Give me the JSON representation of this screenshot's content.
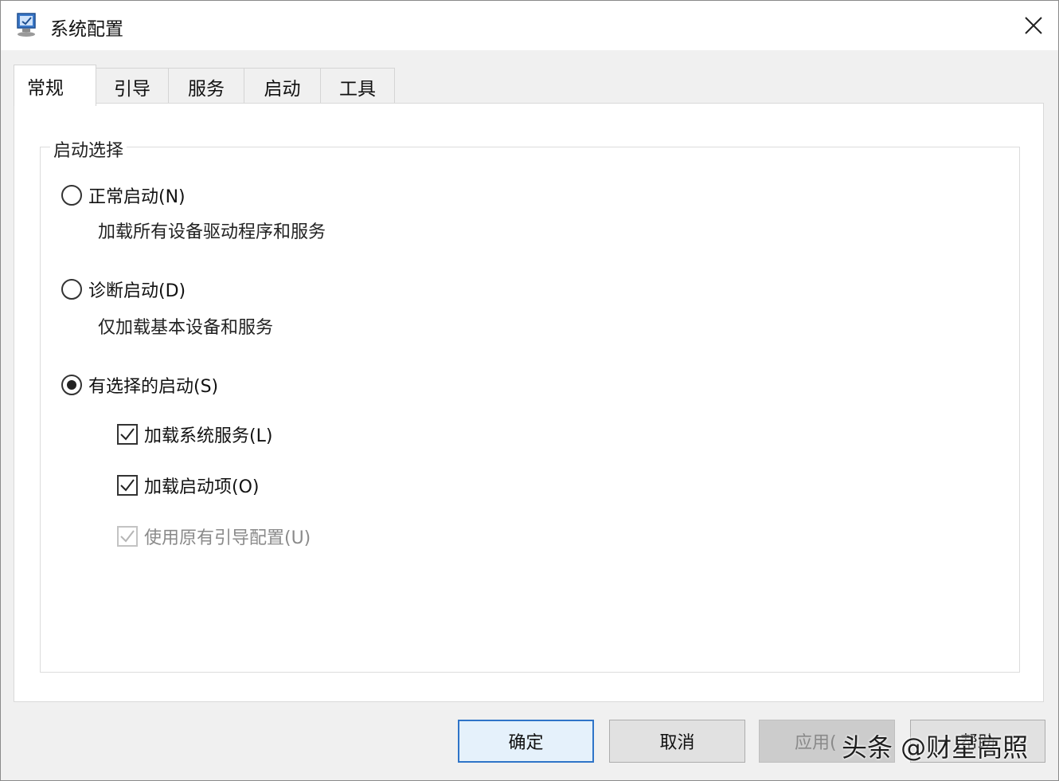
{
  "window": {
    "title": "系统配置",
    "icon": "msconfig-icon",
    "close_icon": "close-icon"
  },
  "tabs": [
    {
      "label": "常规",
      "active": true
    },
    {
      "label": "引导",
      "active": false
    },
    {
      "label": "服务",
      "active": false
    },
    {
      "label": "启动",
      "active": false
    },
    {
      "label": "工具",
      "active": false
    }
  ],
  "startup_selection": {
    "legend": "启动选择",
    "options": [
      {
        "label": "正常启动(N)",
        "description": "加载所有设备驱动程序和服务",
        "selected": false
      },
      {
        "label": "诊断启动(D)",
        "description": "仅加载基本设备和服务",
        "selected": false
      },
      {
        "label": "有选择的启动(S)",
        "selected": true
      }
    ],
    "selective_items": [
      {
        "label": "加载系统服务(L)",
        "checked": true,
        "enabled": true
      },
      {
        "label": "加载启动项(O)",
        "checked": true,
        "enabled": true
      },
      {
        "label": "使用原有引导配置(U)",
        "checked": true,
        "enabled": false
      }
    ]
  },
  "buttons": {
    "ok": "确定",
    "cancel": "取消",
    "apply": "应用(",
    "help": "帮助"
  },
  "watermark": "头条 @财星高照",
  "colors": {
    "primary_border": "#2f74c8",
    "disabled_text": "#8a8a8a"
  }
}
